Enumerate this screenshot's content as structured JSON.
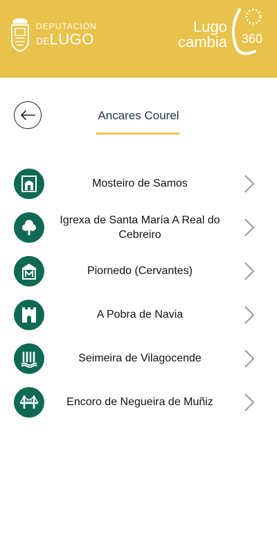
{
  "header": {
    "dep_line1": "DEPUTACIÓN",
    "dep_line2_prefix": "DE",
    "dep_line2_main": "LUGO",
    "lugo_line1": "Lugo",
    "lugo_line2": "cambia",
    "lugo_badge": "360",
    "background_color": "#e8c24a"
  },
  "title": "Ancares Courel",
  "back_icon": "arrow-left-icon",
  "items": [
    {
      "label": "Mosteiro de Samos",
      "icon": "church-icon"
    },
    {
      "label": "Igrexa de Santa María A Real do Cebreiro",
      "icon": "tree-icon"
    },
    {
      "label": "Piornedo (Cervantes)",
      "icon": "museum-icon"
    },
    {
      "label": "A Pobra de Navia",
      "icon": "castle-icon"
    },
    {
      "label": "Seimeira de Vilagocende",
      "icon": "waterfall-icon"
    },
    {
      "label": "Encoro de Negueira de Muñiz",
      "icon": "bridge-icon"
    }
  ],
  "colors": {
    "accent": "#e8c24a",
    "icon_bg": "#0f6a53",
    "title_text": "#1f3440"
  }
}
